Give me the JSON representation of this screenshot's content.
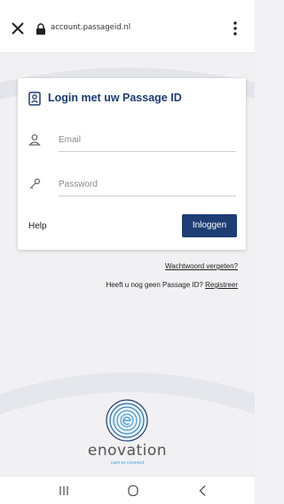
{
  "browser": {
    "url": "account.passageid.nl",
    "icons": {
      "close": "close-icon",
      "lock": "lock-icon",
      "menu": "more-vert-icon"
    }
  },
  "login": {
    "title": "Login met uw Passage ID",
    "email_placeholder": "Email",
    "password_placeholder": "Password",
    "help_label": "Help",
    "submit_label": "Inloggen",
    "icons": {
      "title": "id-badge-icon",
      "email": "user-icon",
      "password": "key-icon"
    }
  },
  "links": {
    "forgot_password": "Wachtwoord vergeten?",
    "no_account_text": "Heeft u nog geen Passage ID?",
    "register_label": "Registreer"
  },
  "brand": {
    "name": "enovation",
    "tagline": "care to connect",
    "colors": {
      "primary": "#1d3d73",
      "accent": "#4aa3d8"
    }
  },
  "nav": {
    "icons": {
      "recent": "recent-apps-icon",
      "home": "home-icon",
      "back": "back-icon"
    }
  }
}
